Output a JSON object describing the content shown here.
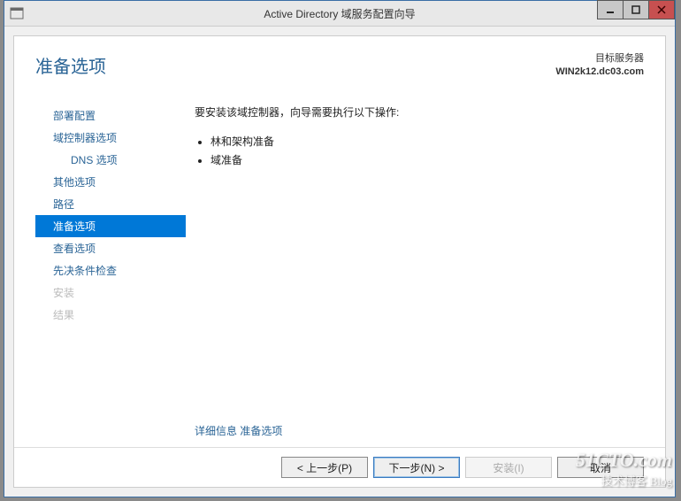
{
  "window": {
    "title": "Active Directory 域服务配置向导"
  },
  "header": {
    "page_title": "准备选项",
    "target_label": "目标服务器",
    "target_server": "WIN2k12.dc03.com"
  },
  "nav": {
    "items": [
      {
        "label": "部署配置",
        "active": false,
        "disabled": false,
        "sub": false
      },
      {
        "label": "域控制器选项",
        "active": false,
        "disabled": false,
        "sub": false
      },
      {
        "label": "DNS 选项",
        "active": false,
        "disabled": false,
        "sub": true
      },
      {
        "label": "其他选项",
        "active": false,
        "disabled": false,
        "sub": false
      },
      {
        "label": "路径",
        "active": false,
        "disabled": false,
        "sub": false
      },
      {
        "label": "准备选项",
        "active": true,
        "disabled": false,
        "sub": false
      },
      {
        "label": "查看选项",
        "active": false,
        "disabled": false,
        "sub": false
      },
      {
        "label": "先决条件检查",
        "active": false,
        "disabled": false,
        "sub": false
      },
      {
        "label": "安装",
        "active": false,
        "disabled": true,
        "sub": false
      },
      {
        "label": "结果",
        "active": false,
        "disabled": true,
        "sub": false
      }
    ]
  },
  "main": {
    "intro": "要安装该域控制器，向导需要执行以下操作:",
    "bullets": [
      "林和架构准备",
      "域准备"
    ],
    "more_info_prefix": "详细信息",
    "more_info_link": "准备选项"
  },
  "footer": {
    "prev": "< 上一步(P)",
    "next": "下一步(N) >",
    "install": "安装(I)",
    "cancel": "取消"
  },
  "watermark": {
    "line1": "51CTO.com",
    "line2": "技术博客  Blog"
  }
}
